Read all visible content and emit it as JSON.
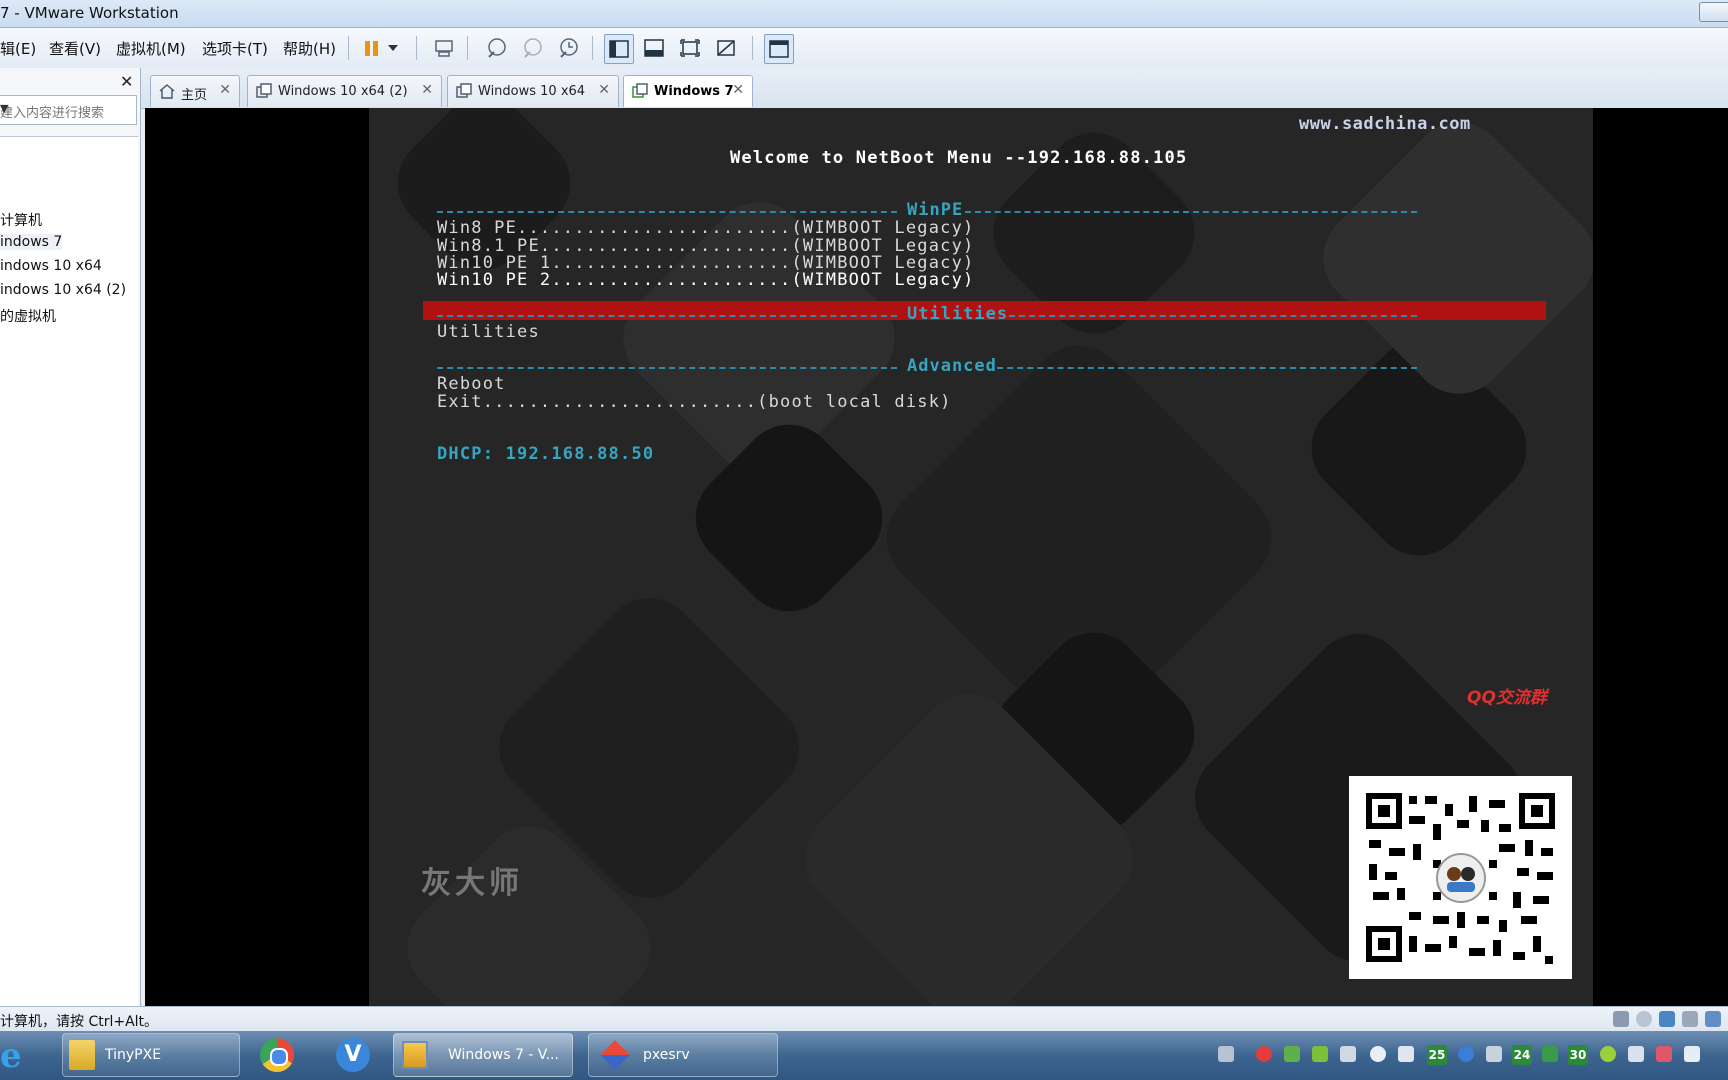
{
  "window": {
    "title": "7 - VMware Workstation"
  },
  "menu": [
    "辑(E)",
    "查看(V)",
    "虚拟机(M)",
    "选项卡(T)",
    "帮助(H)"
  ],
  "sidebar": {
    "search_placeholder": "建入内容进行搜索",
    "items": [
      "计算机",
      "indows 7",
      "indows 10 x64",
      "indows 10 x64 (2)",
      "的虚拟机"
    ]
  },
  "tabs": [
    {
      "label": "主页"
    },
    {
      "label": "Windows 10 x64 (2)"
    },
    {
      "label": "Windows 10 x64"
    },
    {
      "label": "Windows 7"
    }
  ],
  "vm": {
    "watermark_url": "www.sadchina.com",
    "header": "Welcome to NetBoot Menu --192.168.88.105",
    "sections": {
      "winpe": "WinPE",
      "utilities": "Utilities",
      "advanced": "Advanced"
    },
    "winpe_items": [
      "Win8 PE........................(WIMBOOT Legacy)",
      "Win8.1 PE......................(WIMBOOT Legacy)",
      "Win10 PE 1.....................(WIMBOOT Legacy)",
      "Win10 PE 2.....................(WIMBOOT Legacy)"
    ],
    "utilities_items": [
      "Utilities"
    ],
    "advanced_items": [
      "Reboot",
      "Exit........................(boot local disk)"
    ],
    "dhcp": "DHCP: 192.168.88.50",
    "logo_text": "灰大师",
    "qq_label": "QQ交流群",
    "colors": {
      "highlight": "#b01212",
      "cyan": "#36a5c2"
    }
  },
  "status": {
    "message": "计算机，请按 Ctrl+Alt。"
  },
  "taskbar": {
    "items": [
      "TinyPXE",
      "Windows 7 - V...",
      "pxesrv"
    ],
    "tray_numbers": [
      "25",
      "24",
      "30"
    ]
  }
}
